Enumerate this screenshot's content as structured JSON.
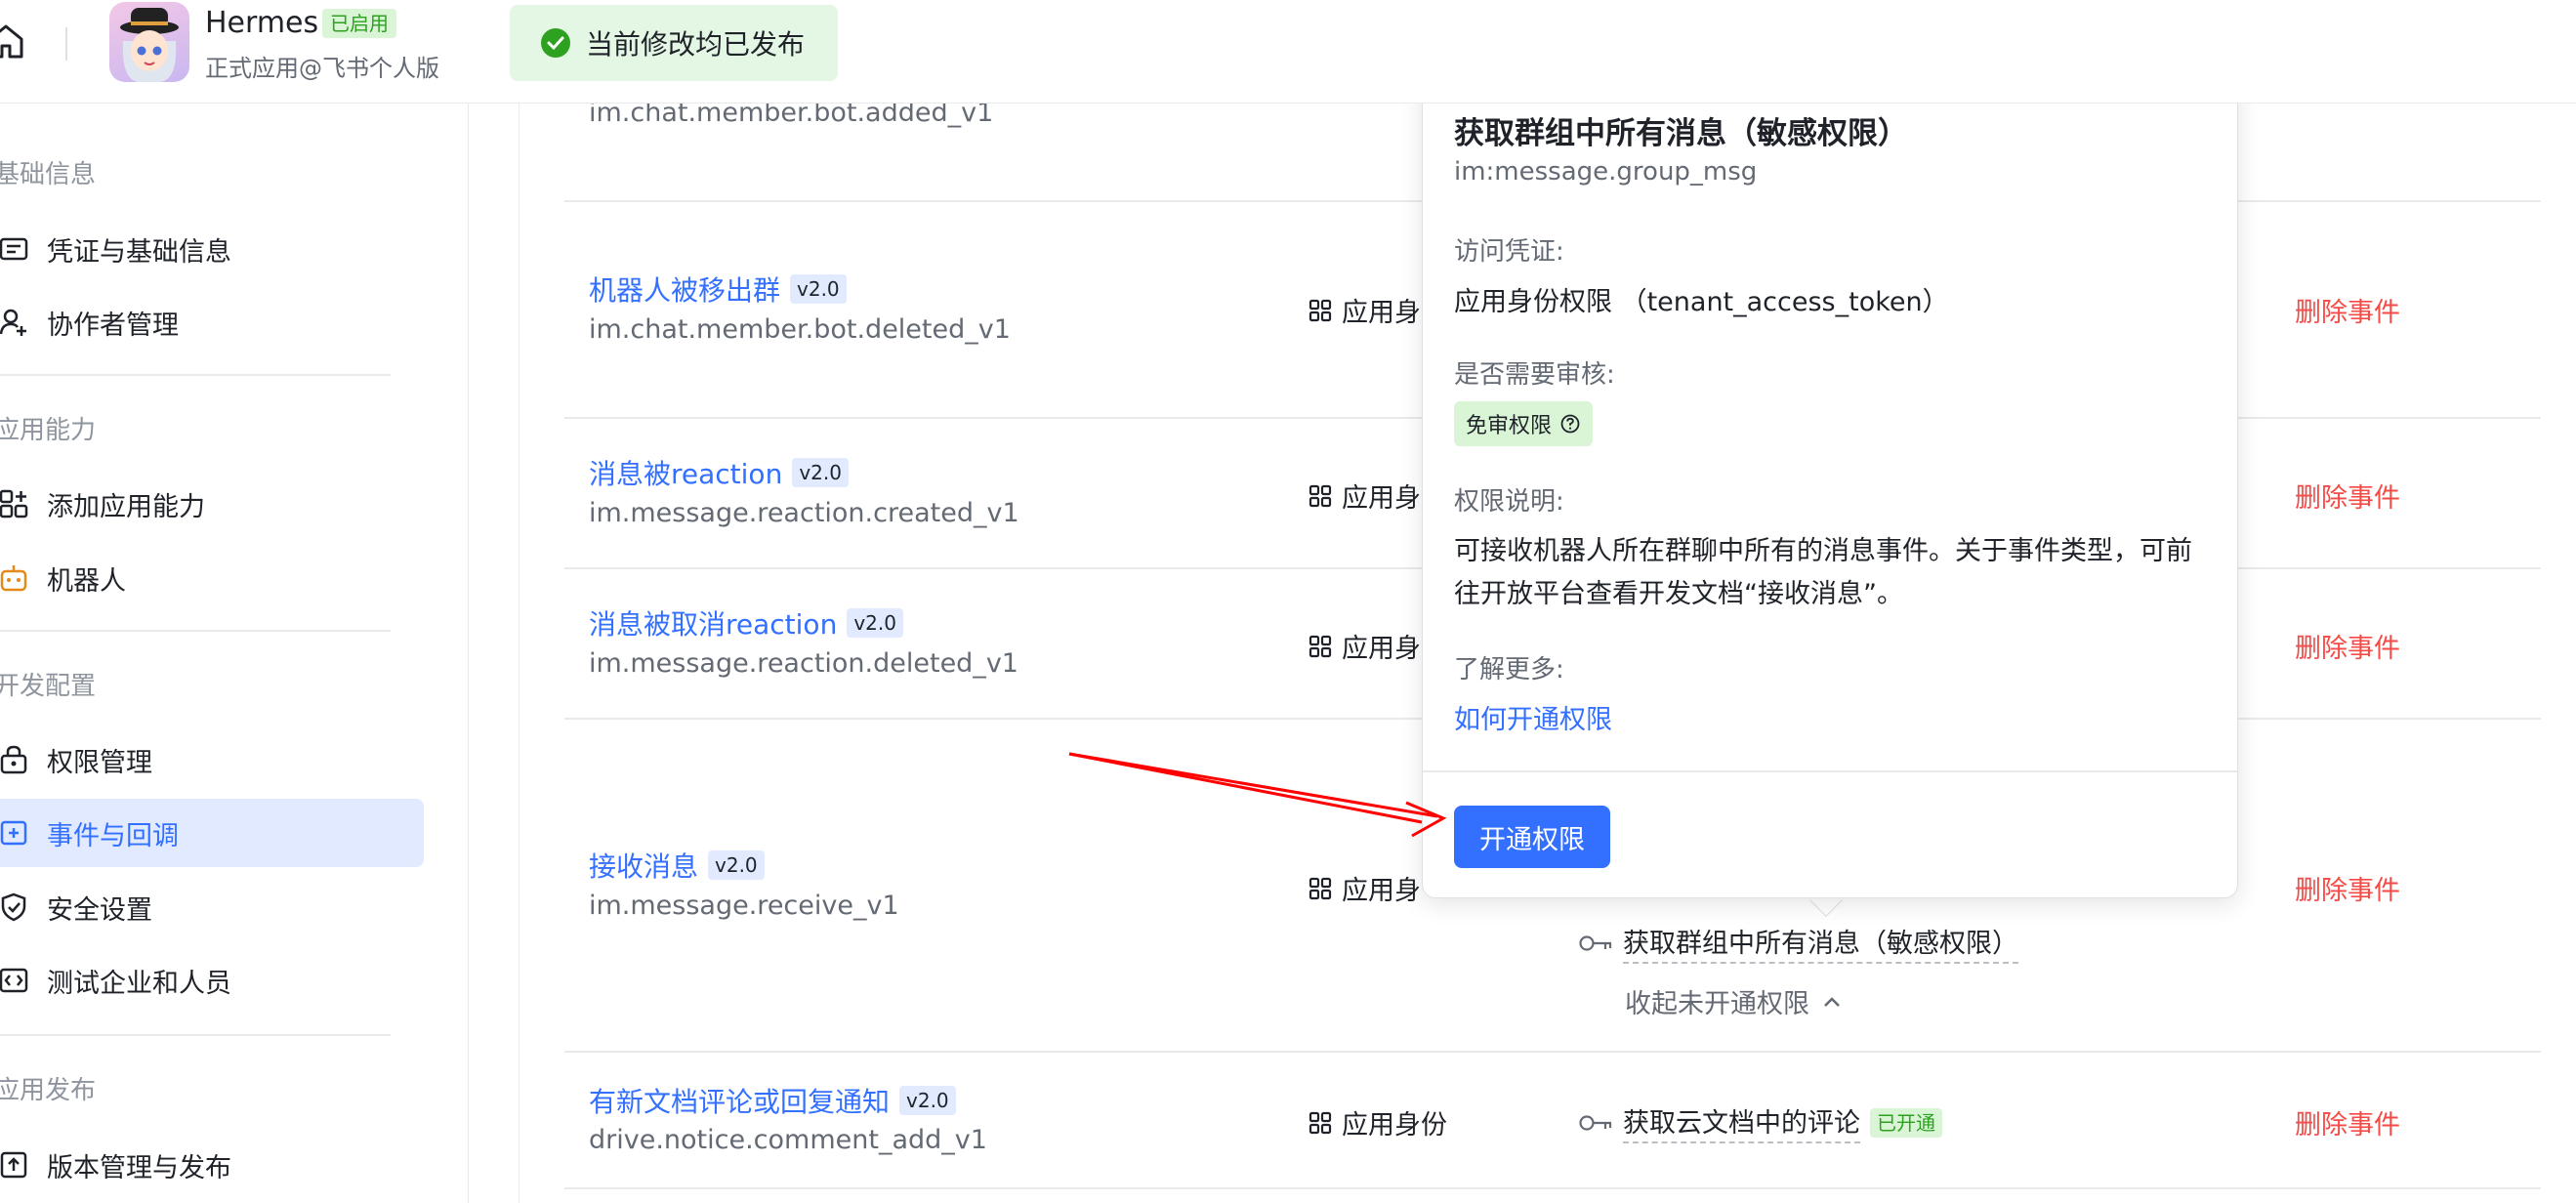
{
  "header": {
    "app_name": "Hermes",
    "status": "已启用",
    "subtitle": "正式应用@飞书个人版"
  },
  "toast": {
    "text": "当前修改均已发布"
  },
  "sidebar": {
    "sections": [
      {
        "title": "基础信息",
        "items": [
          "凭证与基础信息",
          "协作者管理"
        ]
      },
      {
        "title": "应用能力",
        "items": [
          "添加应用能力",
          "机器人"
        ]
      },
      {
        "title": "开发配置",
        "items": [
          "权限管理",
          "事件与回调",
          "安全设置",
          "测试企业和人员"
        ]
      },
      {
        "title": "应用发布",
        "items": [
          "版本管理与发布"
        ]
      }
    ],
    "active_item": "事件与回调"
  },
  "events": [
    {
      "id": "im.chat.member.bot.added_v1"
    },
    {
      "title": "机器人被移出群",
      "version": "v2.0",
      "id": "im.chat.member.bot.deleted_v1",
      "identity": "应用身",
      "action": "删除事件"
    },
    {
      "title": "消息被reaction",
      "version": "v2.0",
      "id": "im.message.reaction.created_v1",
      "identity": "应用身",
      "action": "删除事件"
    },
    {
      "title": "消息被取消reaction",
      "version": "v2.0",
      "id": "im.message.reaction.deleted_v1",
      "identity": "应用身",
      "action": "删除事件"
    },
    {
      "title": "接收消息",
      "version": "v2.0",
      "id": "im.message.receive_v1",
      "identity": "应用身",
      "action": "删除事件",
      "permission": "获取群组中所有消息（敏感权限）",
      "collapse_label": "收起未开通权限"
    },
    {
      "title": "有新文档评论或回复通知",
      "version": "v2.0",
      "id": "drive.notice.comment_add_v1",
      "identity": "应用身份",
      "action": "删除事件",
      "permission": "获取云文档中的评论",
      "permission_status": "已开通"
    }
  ],
  "popover": {
    "title": "获取群组中所有消息（敏感权限）",
    "scope": "im:message.group_msg",
    "token_heading": "访问凭证:",
    "token_value": "应用身份权限 （tenant_access_token）",
    "review_heading": "是否需要审核:",
    "review_tag": "免审权限",
    "desc_heading": "权限说明:",
    "desc": "可接收机器人所在群聊中所有的消息事件。关于事件类型，可前往开放平台查看开发文档“接收消息”。",
    "more_heading": "了解更多:",
    "more_link": "如何开通权限",
    "button": "开通权限"
  },
  "colors": {
    "accent": "#3370ff",
    "danger": "#f54a45",
    "success": "#2ea121",
    "annotation": "#ff0000"
  }
}
